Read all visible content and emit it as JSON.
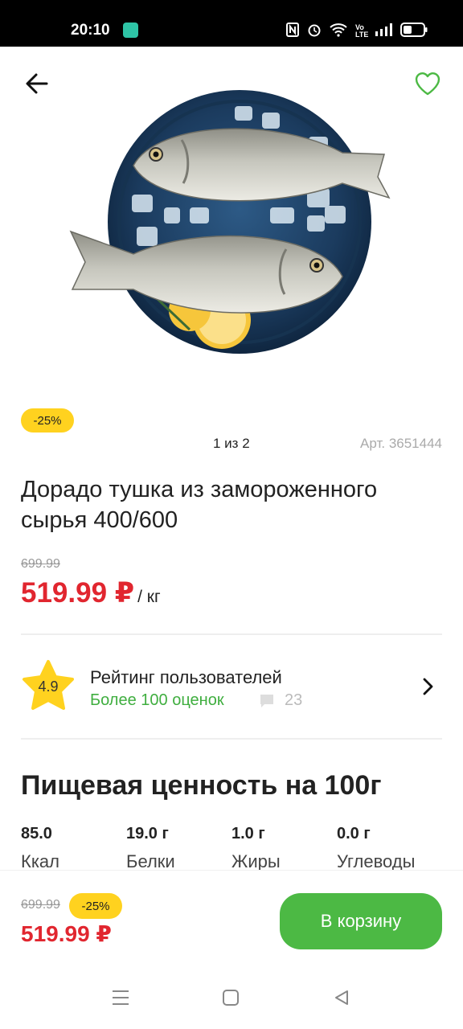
{
  "status_bar": {
    "time": "20:10",
    "icons": [
      "nfc-icon",
      "alarm-icon",
      "wifi-icon",
      "volte-icon",
      "signal-icon",
      "battery-icon"
    ],
    "volte_text": "Vo LTE"
  },
  "header": {
    "back_icon": "arrow-left-icon",
    "favorite_icon": "heart-icon"
  },
  "product": {
    "image_icon": "dorado-fish-image",
    "discount": "-25%",
    "pager": "1 из 2",
    "article": "Арт. 3651444",
    "title": "Дорадо тушка из замороженного сырья 400/600",
    "old_price": "699.99",
    "price": "519.99 ₽",
    "unit": "/ кг"
  },
  "rating": {
    "value": "4.9",
    "title": "Рейтинг пользователей",
    "count_text": "Более 100 оценок",
    "comments": "23"
  },
  "nutrition": {
    "title": "Пищевая ценность на 100г",
    "items": [
      {
        "value": "85.0",
        "label": "Ккал"
      },
      {
        "value": "19.0 г",
        "label": "Белки"
      },
      {
        "value": "1.0 г",
        "label": "Жиры"
      },
      {
        "value": "0.0 г",
        "label": "Углеводы"
      }
    ]
  },
  "bottom_bar": {
    "old_price": "699.99",
    "discount": "-25%",
    "price": "519.99 ₽",
    "cart_label": "В корзину"
  },
  "colors": {
    "accent_green": "#4cb944",
    "price_red": "#e1262f",
    "badge_yellow": "#ffd21f"
  }
}
